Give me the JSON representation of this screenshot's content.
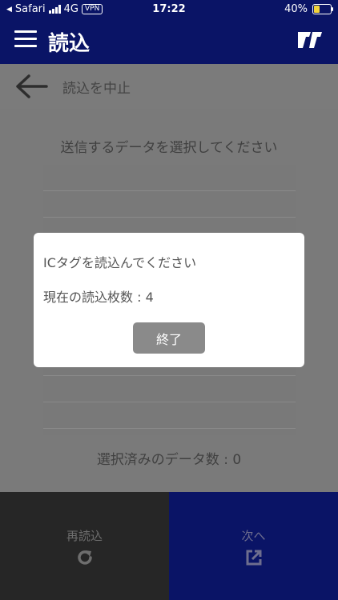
{
  "status_bar": {
    "carrier": "Safari",
    "network": "4G",
    "vpn": "VPN",
    "time": "17:22",
    "battery_percent": "40%",
    "battery_level": 0.4,
    "battery_color": "#f2d33a"
  },
  "header": {
    "title": "読込",
    "menu_icon": "menu-icon",
    "logo_icon": "logo-icon"
  },
  "sub_header": {
    "back_icon": "arrow-left-icon",
    "label": "読込を中止"
  },
  "main": {
    "select_prompt": "送信するデータを選択してください",
    "selected_count_label": "選択済みのデータ数 : 0"
  },
  "dialog": {
    "message": "ICタグを読込んでください",
    "count_label": "現在の読込枚数 : 4",
    "button_label": "終了"
  },
  "footer": {
    "reread_label": "再読込",
    "reread_icon": "refresh-icon",
    "next_label": "次へ",
    "next_icon": "external-link-icon"
  },
  "colors": {
    "brand_navy": "#0a1466",
    "overlay_gray": "#7a7a7a",
    "footer_dark": "#262626"
  }
}
